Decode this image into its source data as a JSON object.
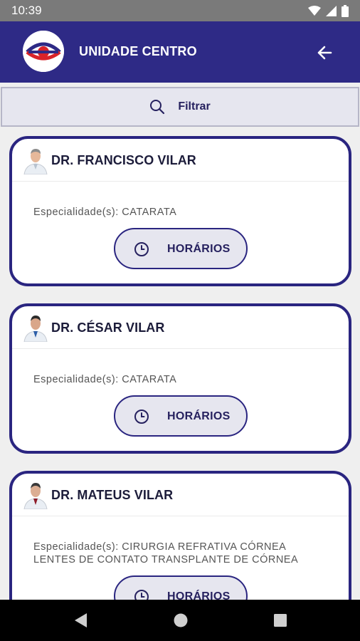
{
  "status_bar": {
    "time": "10:39"
  },
  "header": {
    "title": "UNIDADE CENTRO"
  },
  "filter": {
    "label": "Filtrar"
  },
  "doctors": [
    {
      "name": "DR. FRANCISCO VILAR",
      "specialties": "Especialidade(s): CATARATA",
      "button_label": "HORÁRIOS"
    },
    {
      "name": "DR. CÉSAR VILAR",
      "specialties": "Especialidade(s): CATARATA",
      "button_label": "HORÁRIOS"
    },
    {
      "name": "DR. MATEUS VILAR",
      "specialties": "Especialidade(s): CIRURGIA REFRATIVA CÓRNEA LENTES DE CONTATO TRANSPLANTE DE CÓRNEA",
      "button_label": "HORÁRIOS"
    }
  ],
  "colors": {
    "primary": "#2e2a86",
    "card_border": "#2a2580",
    "button_bg": "#e6e6ef",
    "logo_red": "#d8232a"
  },
  "icons": {
    "back": "arrow-left-icon",
    "search": "search-icon",
    "clock": "clock-icon",
    "nav_back": "triangle-back-icon",
    "nav_home": "circle-home-icon",
    "nav_recents": "square-recents-icon"
  }
}
